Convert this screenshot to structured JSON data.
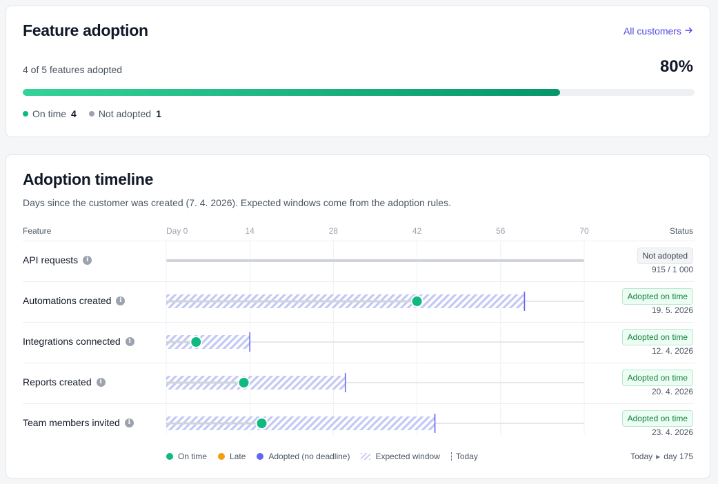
{
  "summary": {
    "title": "Feature adoption",
    "link_label": "All customers",
    "link_icon": "arrow-right-icon",
    "adopted_text": "4 of 5 features adopted",
    "percent_label": "80%",
    "progress_fraction": 0.8,
    "legend": [
      {
        "label": "On time",
        "count": "4",
        "color": "#10b981"
      },
      {
        "label": "Not adopted",
        "count": "1",
        "color": "#9ca3af"
      }
    ]
  },
  "timeline": {
    "title": "Adoption timeline",
    "subtitle": "Days since the customer was created (7. 4. 2026). Expected windows come from the adoption rules.",
    "col_feature": "Feature",
    "col_status": "Status",
    "ticks": [
      "Day 0",
      "14",
      "28",
      "42",
      "56",
      "70"
    ],
    "axis_max_day": 70,
    "rows": [
      {
        "label": "API requests",
        "status": "Not adopted",
        "status_kind": "neutral",
        "detail": "915 / 1 000",
        "window_end": null,
        "adopted_day": null,
        "progress_to": 70
      },
      {
        "label": "Automations created",
        "status": "Adopted on time",
        "status_kind": "good",
        "detail": "19. 5. 2026",
        "window_end": 60,
        "adopted_day": 42
      },
      {
        "label": "Integrations connected",
        "status": "Adopted on time",
        "status_kind": "good",
        "detail": "12. 4. 2026",
        "window_end": 14,
        "adopted_day": 5
      },
      {
        "label": "Reports created",
        "status": "Adopted on time",
        "status_kind": "good",
        "detail": "20. 4. 2026",
        "window_end": 30,
        "adopted_day": 13
      },
      {
        "label": "Team members invited",
        "status": "Adopted on time",
        "status_kind": "good",
        "detail": "23. 4. 2026",
        "window_end": 45,
        "adopted_day": 16
      }
    ],
    "legend": [
      {
        "label": "On time",
        "kind": "dot",
        "color": "#10b981"
      },
      {
        "label": "Late",
        "kind": "dot",
        "color": "#f59e0b"
      },
      {
        "label": "Adopted (no deadline)",
        "kind": "dot",
        "color": "#6366f1"
      },
      {
        "label": "Expected window",
        "kind": "hatch"
      },
      {
        "label": "Today",
        "kind": "today"
      }
    ],
    "today_prefix": "Today",
    "today_value": "day 175"
  }
}
